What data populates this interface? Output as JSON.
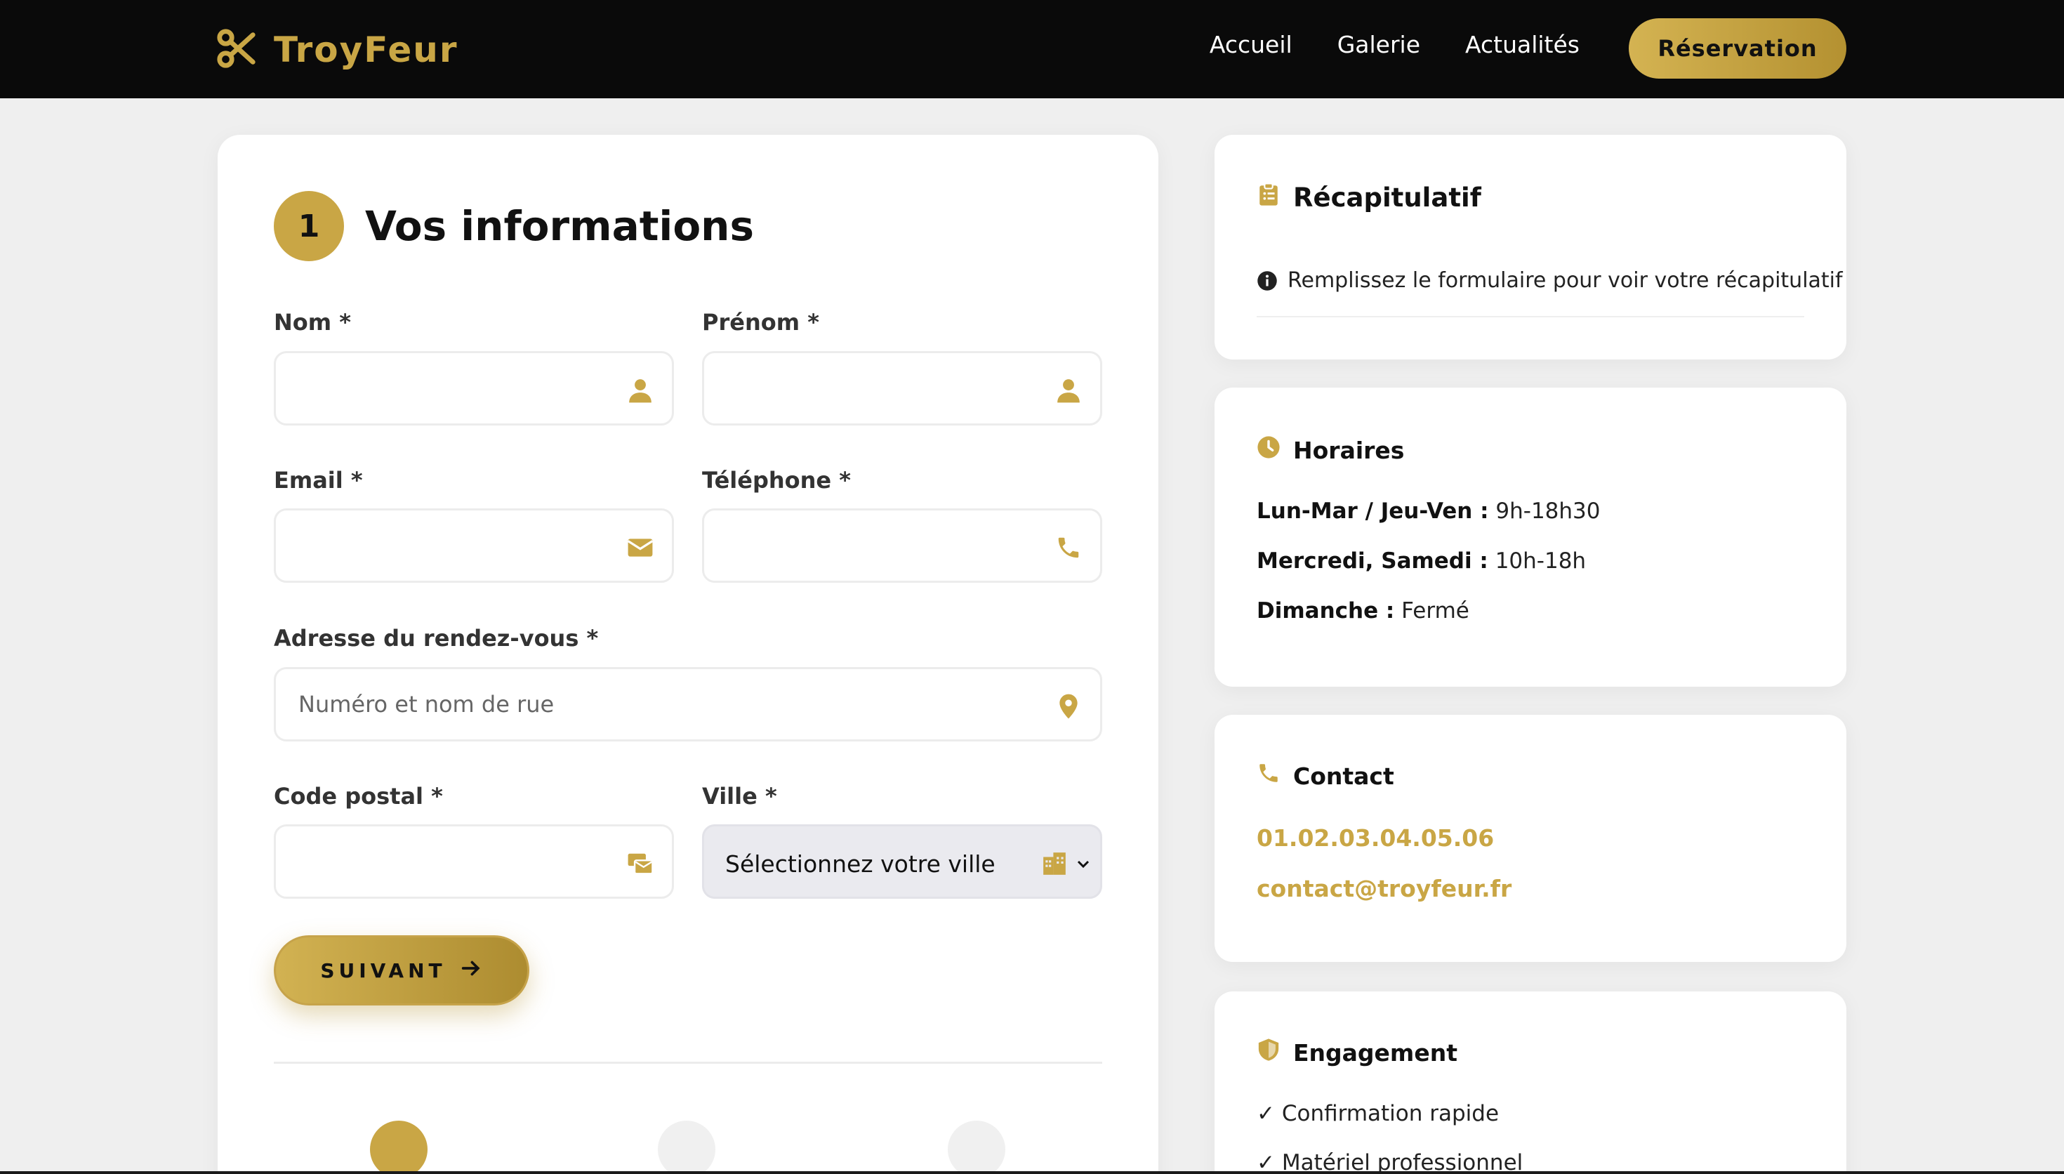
{
  "nav": {
    "brand": "TroyFeur",
    "links": [
      "Accueil",
      "Galerie",
      "Actualités"
    ],
    "cta": "Réservation"
  },
  "form": {
    "step_number": "1",
    "step_title": "Vos informations",
    "fields": {
      "nom": {
        "label": "Nom *",
        "value": "",
        "placeholder": ""
      },
      "prenom": {
        "label": "Prénom *",
        "value": "",
        "placeholder": ""
      },
      "email": {
        "label": "Email *",
        "value": "",
        "placeholder": ""
      },
      "telephone": {
        "label": "Téléphone *",
        "value": "",
        "placeholder": ""
      },
      "adresse": {
        "label": "Adresse du rendez-vous *",
        "value": "",
        "placeholder": "Numéro et nom de rue"
      },
      "code_postal": {
        "label": "Code postal *",
        "value": "",
        "placeholder": ""
      },
      "ville": {
        "label": "Ville *",
        "selected": "Sélectionnez votre ville"
      }
    },
    "next_button": "SUIVANT",
    "steps_total": 3,
    "current_step": 1
  },
  "recap": {
    "title": "Récapitulatif",
    "info": "Remplissez le formulaire pour voir votre récapitulatif"
  },
  "horaires": {
    "title": "Horaires",
    "rows": [
      {
        "days": "Lun-Mar / Jeu-Ven :",
        "hours": "9h-18h30"
      },
      {
        "days": "Mercredi, Samedi :",
        "hours": "10h-18h"
      },
      {
        "days": "Dimanche :",
        "hours": "Fermé"
      }
    ]
  },
  "contact": {
    "title": "Contact",
    "phone": "01.02.03.04.05.06",
    "email": "contact@troyfeur.fr"
  },
  "engagement": {
    "title": "Engagement",
    "items": [
      "✓ Confirmation rapide",
      "✓ Matériel professionnel"
    ]
  },
  "colors": {
    "gold": "#c9a645",
    "nav_bg": "#0a0a0a",
    "page_bg": "#efefef"
  }
}
